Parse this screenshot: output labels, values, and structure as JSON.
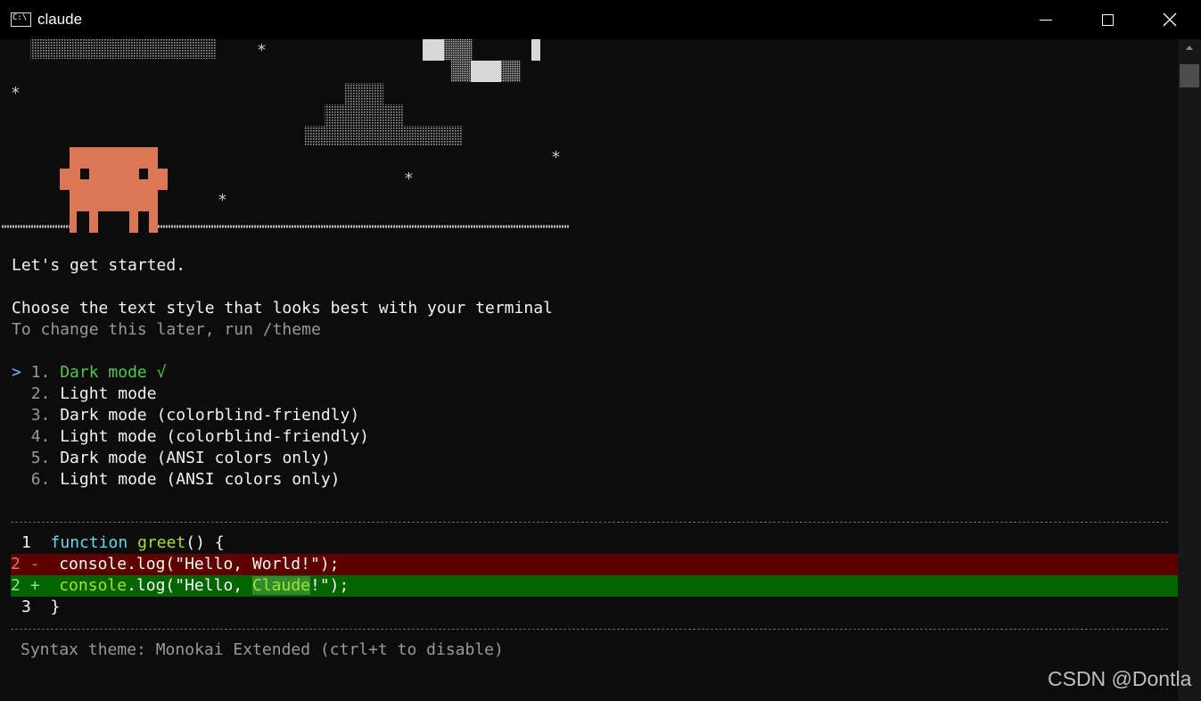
{
  "window": {
    "title": "claude",
    "icon": "console-app-icon",
    "icon_text": "C:\\"
  },
  "intro": {
    "greeting": "Let's get started.",
    "heading": "Choose the text style that looks best with your terminal",
    "hint": "To change this later, run /theme"
  },
  "theme_options": [
    {
      "marker": ">",
      "number": "1.",
      "label": "Dark mode √",
      "selected": true
    },
    {
      "marker": " ",
      "number": "2.",
      "label": "Light mode",
      "selected": false
    },
    {
      "marker": " ",
      "number": "3.",
      "label": "Dark mode (colorblind-friendly)",
      "selected": false
    },
    {
      "marker": " ",
      "number": "4.",
      "label": "Light mode (colorblind-friendly)",
      "selected": false
    },
    {
      "marker": " ",
      "number": "5.",
      "label": "Dark mode (ANSI colors only)",
      "selected": false
    },
    {
      "marker": " ",
      "number": "6.",
      "label": "Light mode (ANSI colors only)",
      "selected": false
    }
  ],
  "code_preview": {
    "line1": {
      "num": "1",
      "keyword": "function",
      "name": "greet",
      "rest": "() {"
    },
    "line2": {
      "num": "2",
      "sign": "-",
      "code": "console.log(\"Hello, World!\");"
    },
    "line3": {
      "num": "2",
      "sign": "+",
      "prefix": "console",
      "middle": ".log(\"Hello, ",
      "highlight": "Claude",
      "suffix": "!\");"
    },
    "line4": {
      "num": "3",
      "code": "}"
    }
  },
  "footer": {
    "syntax_theme": "Syntax theme: Monokai Extended (ctrl+t to disable)"
  },
  "watermark": "CSDN @Dontla",
  "colors": {
    "background": "#0c0c0c",
    "mascot": "#d97757",
    "selected": "#4ec94e",
    "diff_removed": "#5f0000",
    "diff_added": "#006400"
  }
}
